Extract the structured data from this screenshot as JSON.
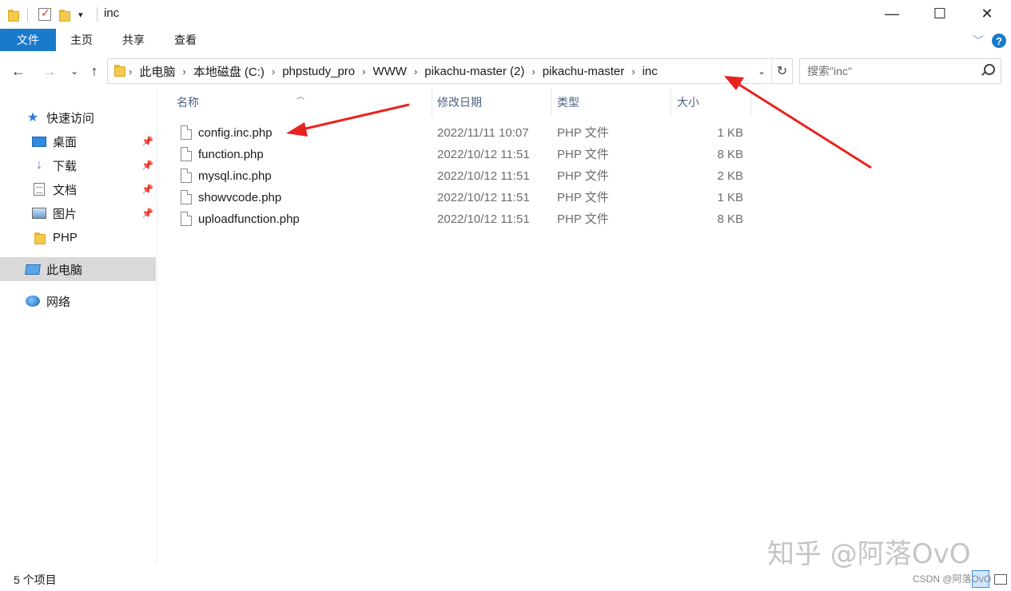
{
  "window": {
    "title": "inc",
    "controls": {
      "minimize": "—",
      "maximize": "☐",
      "close": "✕"
    }
  },
  "ribbon": {
    "tabs": [
      "文件",
      "主页",
      "共享",
      "查看"
    ],
    "help": "?"
  },
  "address_bar": {
    "crumbs": [
      "此电脑",
      "本地磁盘 (C:)",
      "phpstudy_pro",
      "WWW",
      "pikachu-master (2)",
      "pikachu-master",
      "inc"
    ]
  },
  "search": {
    "placeholder": "搜索\"inc\""
  },
  "sidebar": {
    "items": [
      {
        "label": "快速访问",
        "icon": "star-icon"
      },
      {
        "label": "桌面",
        "icon": "desktop-icon",
        "pinned": true
      },
      {
        "label": "下载",
        "icon": "download-icon",
        "pinned": true
      },
      {
        "label": "文档",
        "icon": "document-icon",
        "pinned": true
      },
      {
        "label": "图片",
        "icon": "pictures-icon",
        "pinned": true
      },
      {
        "label": "PHP",
        "icon": "folder-icon"
      },
      {
        "label": "此电脑",
        "icon": "computer-icon",
        "selected": true
      },
      {
        "label": "网络",
        "icon": "network-icon"
      }
    ]
  },
  "file_list": {
    "columns": [
      "名称",
      "修改日期",
      "类型",
      "大小"
    ],
    "rows": [
      {
        "name": "config.inc.php",
        "modified": "2022/11/11 10:07",
        "type": "PHP 文件",
        "size": "1 KB"
      },
      {
        "name": "function.php",
        "modified": "2022/10/12 11:51",
        "type": "PHP 文件",
        "size": "8 KB"
      },
      {
        "name": "mysql.inc.php",
        "modified": "2022/10/12 11:51",
        "type": "PHP 文件",
        "size": "2 KB"
      },
      {
        "name": "showvcode.php",
        "modified": "2022/10/12 11:51",
        "type": "PHP 文件",
        "size": "1 KB"
      },
      {
        "name": "uploadfunction.php",
        "modified": "2022/10/12 11:51",
        "type": "PHP 文件",
        "size": "8 KB"
      }
    ]
  },
  "status_bar": {
    "item_count": "5 个项目"
  },
  "watermark": {
    "zhihu": "知乎 @阿落OvO",
    "csdn": "CSDN @阿落OvO"
  },
  "colors": {
    "accent": "#1979ca",
    "annotation_arrow": "#e8231f",
    "selection": "#d9d9d9"
  }
}
